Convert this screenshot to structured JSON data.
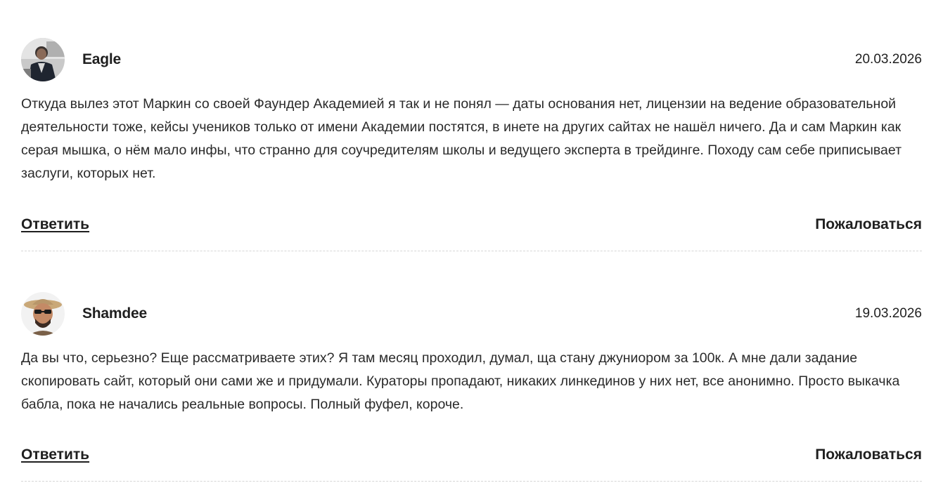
{
  "comments": [
    {
      "author": "Eagle",
      "date": "20.03.2026",
      "text": "Откуда вылез этот Маркин со своей Фаундер Академией я так и не понял — даты основания нет, лицензии на ведение образовательной деятельности тоже, кейсы учеников только от имени Академии постятся, в инете на других сайтах не нашёл ничего. Да и сам Маркин как серая мышка, о нём мало инфы, что странно для соучредителям школы и ведущего эксперта в трейдинге. Походу сам себе приписывает заслуги, которых нет.",
      "reply_label": "Ответить",
      "report_label": "Пожаловаться",
      "avatar_icon": "user-photo-avatar"
    },
    {
      "author": "Shamdee",
      "date": "19.03.2026",
      "text": "Да вы что, серьезно? Еще рассматриваете этих? Я там месяц проходил, думал, ща стану джуниором за 100к. А мне дали задание скопировать сайт, который они сами же и придумали. Кураторы пропадают, никаких линкединов у них нет, все анонимно. Просто выкачка бабла, пока не начались реальные вопросы. Полный фуфел, короче.",
      "reply_label": "Ответить",
      "report_label": "Пожаловаться",
      "avatar_icon": "user-photo-avatar"
    }
  ]
}
